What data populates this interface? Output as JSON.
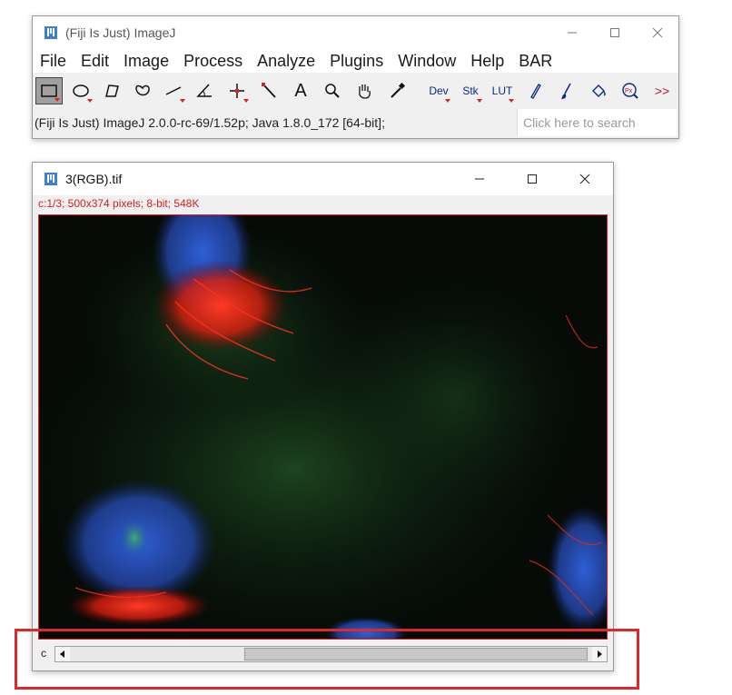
{
  "main_window": {
    "title": "(Fiji Is Just) ImageJ",
    "menu": [
      "File",
      "Edit",
      "Image",
      "Process",
      "Analyze",
      "Plugins",
      "Window",
      "Help",
      "BAR"
    ],
    "tools": {
      "dev": "Dev",
      "stk": "Stk",
      "lut": "LUT",
      "text_tool": "A",
      "more": ">>"
    },
    "status": "(Fiji Is Just) ImageJ 2.0.0-rc-69/1.52p; Java 1.8.0_172 [64-bit];",
    "search_placeholder": "Click here to search"
  },
  "image_window": {
    "title": "3(RGB).tif",
    "info": "c:1/3; 500x374 pixels; 8-bit; 548K",
    "channel_label": "c",
    "slider": {
      "position": "1/3"
    }
  },
  "colors": {
    "highlight": "#e02828",
    "info_text": "#d42020"
  }
}
